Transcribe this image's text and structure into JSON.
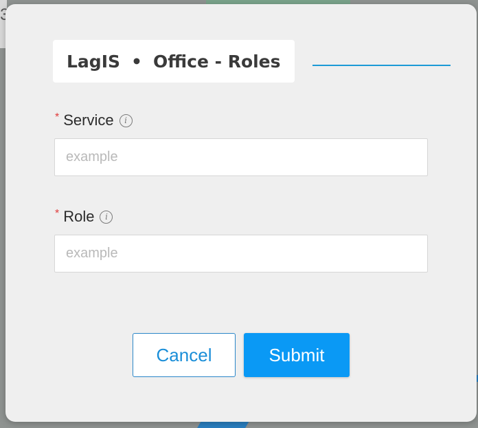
{
  "dialog": {
    "title_app": "LagIS",
    "title_separator": "•",
    "title_section": "Office - Roles"
  },
  "fields": [
    {
      "label": "Service",
      "required_mark": "*",
      "placeholder": "example",
      "value": ""
    },
    {
      "label": "Role",
      "required_mark": "*",
      "placeholder": "example",
      "value": ""
    }
  ],
  "buttons": {
    "cancel_label": "Cancel",
    "submit_label": "Submit"
  },
  "icons": {
    "field_info": "info-icon"
  },
  "colors": {
    "accent": "#0a99f5",
    "required": "#e03b3b",
    "title_underline": "#1b9ad6"
  }
}
